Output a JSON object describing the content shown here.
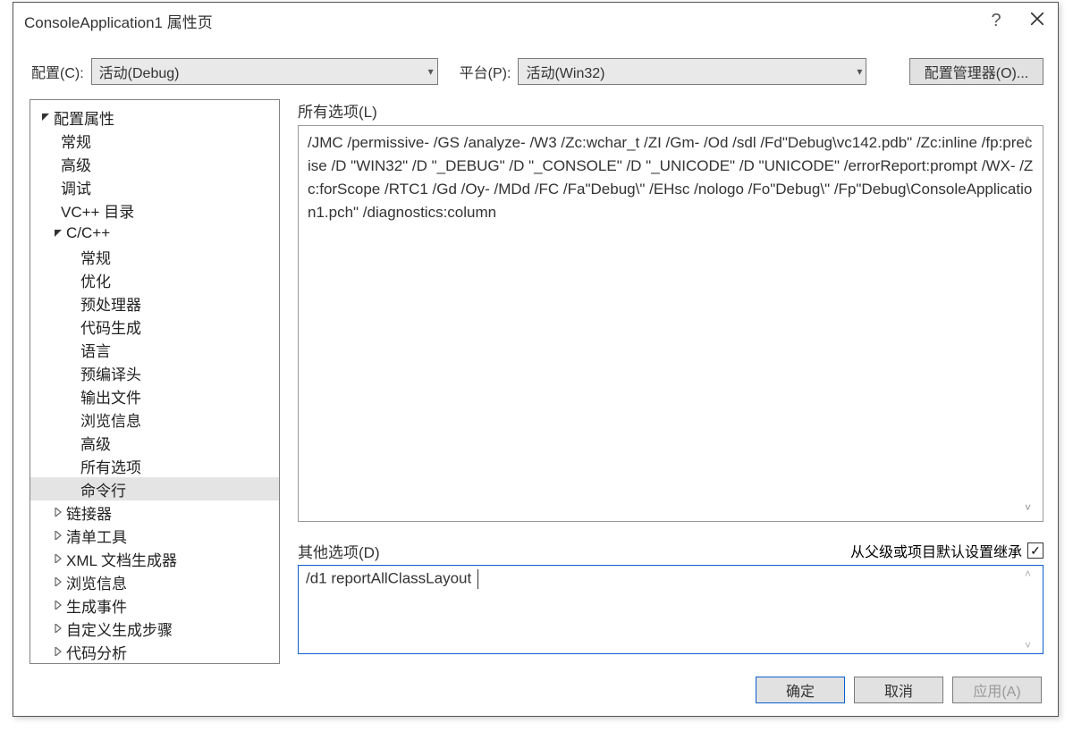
{
  "window": {
    "title": "ConsoleApplication1 属性页"
  },
  "topbar": {
    "config_label": "配置(C):",
    "config_value": "活动(Debug)",
    "platform_label": "平台(P):",
    "platform_value": "活动(Win32)",
    "config_manager_label": "配置管理器(O)..."
  },
  "tree": {
    "config_props": "配置属性",
    "general": "常规",
    "advanced": "高级",
    "debug": "调试",
    "vcpp_dirs": "VC++ 目录",
    "c_cpp": "C/C++",
    "cc_general": "常规",
    "cc_opt": "优化",
    "cc_preproc": "预处理器",
    "cc_codegen": "代码生成",
    "cc_lang": "语言",
    "cc_precomp": "预编译头",
    "cc_outfile": "输出文件",
    "cc_browse": "浏览信息",
    "cc_adv": "高级",
    "cc_allopts": "所有选项",
    "cc_cmdline": "命令行",
    "linker": "链接器",
    "manifest_tool": "清单工具",
    "xml_doc": "XML 文档生成器",
    "browse_info": "浏览信息",
    "build_events": "生成事件",
    "custom_build": "自定义生成步骤",
    "code_analysis": "代码分析"
  },
  "right": {
    "all_opts_label": "所有选项(L)",
    "all_opts_text": "/JMC /permissive- /GS /analyze- /W3 /Zc:wchar_t /ZI /Gm- /Od /sdl /Fd\"Debug\\vc142.pdb\" /Zc:inline /fp:precise /D \"WIN32\" /D \"_DEBUG\" /D \"_CONSOLE\" /D \"_UNICODE\" /D \"UNICODE\" /errorReport:prompt /WX- /Zc:forScope /RTC1 /Gd /Oy- /MDd /FC /Fa\"Debug\\\" /EHsc /nologo /Fo\"Debug\\\" /Fp\"Debug\\ConsoleApplication1.pch\" /diagnostics:column ",
    "other_opts_label": "其他选项(D)",
    "inherit_label": "从父级或项目默认设置继承",
    "other_opts_text": "/d1 reportAllClassLayout "
  },
  "footer": {
    "ok": "确定",
    "cancel": "取消",
    "apply": "应用(A)"
  }
}
